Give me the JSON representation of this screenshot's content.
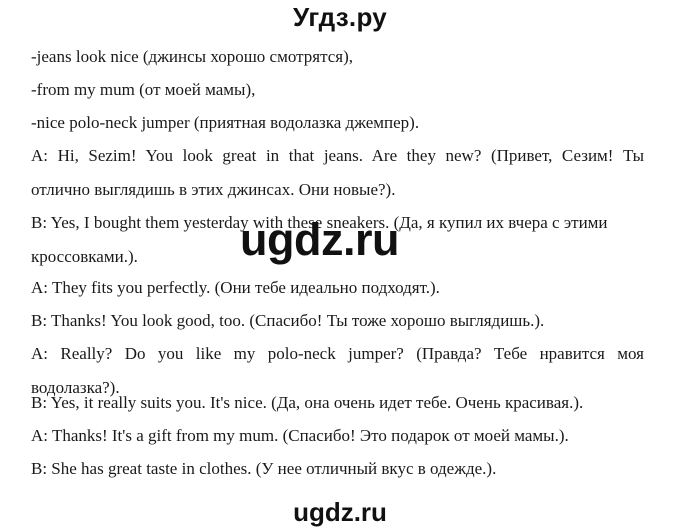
{
  "header": {
    "site": "Угдз.ру"
  },
  "vocab": [
    "-jeans look nice (джинсы хорошо смотрятся),",
    "-from my mum (от моей мамы),",
    "-nice polo-neck jumper (приятная водолазка джемпер)."
  ],
  "dialogue": [
    {
      "line1": "A: Hi, Sezim! You look great in that jeans.  Are they  new? (Привет, Сезим! Ты",
      "line2": "отлично выглядишь в этих джинсах.  Они новые?)."
    },
    {
      "line1": "B: Yes, I bought them yesterday with these sneakers. (Да, я купил их вчера с этими",
      "line2": "кроссовками.)."
    },
    {
      "line1": "A: They fits you perfectly. (Они тебе идеально подходят.)."
    },
    {
      "line1": "B: Thanks! You look good, too. (Спасибо! Ты тоже хорошо выглядишь.)."
    },
    {
      "line1": "A: Really? Do you like my polo-neck jumper? (Правда? Тебе нравится моя",
      "line2": "водолазка?)."
    },
    {
      "line1": "B: Yes, it really suits you. It's nice. (Да, она очень идет тебе. Очень красивая.)."
    },
    {
      "line1": "A: Thanks! It's a gift from my mum. (Спасибо! Это подарок от моей мамы.)."
    },
    {
      "line1": "B: She has great taste in clothes. (У нее отличный вкус в одежде.)."
    }
  ],
  "watermark": "ugdz.ru",
  "footer": {
    "site": "ugdz.ru"
  }
}
